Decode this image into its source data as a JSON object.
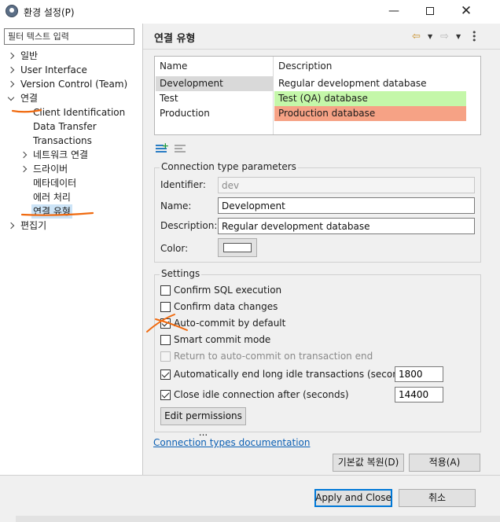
{
  "window": {
    "title": "환경 설정(P)",
    "minimize_glyph": "—",
    "close_glyph": "✕"
  },
  "sidebar": {
    "filter_placeholder": "필터 텍스트 입력",
    "items": [
      {
        "label": "일반",
        "expanded": false
      },
      {
        "label": "User Interface",
        "expanded": false
      },
      {
        "label": "Version Control (Team)",
        "expanded": false
      },
      {
        "label": "연결",
        "expanded": true
      },
      {
        "label": "편집기",
        "expanded": false
      }
    ],
    "connection_children": [
      {
        "label": "Client Identification"
      },
      {
        "label": "Data Transfer"
      },
      {
        "label": "Transactions"
      },
      {
        "label": "네트워크 연결",
        "has_children": true
      },
      {
        "label": "드라이버",
        "has_children": true
      },
      {
        "label": "메타데이터"
      },
      {
        "label": "에러 처리"
      },
      {
        "label": "연결 유형",
        "selected": true
      }
    ]
  },
  "page": {
    "title": "연결 유형",
    "icons": [
      "back-arrow-icon",
      "forward-arrow-icon",
      "more-vertical-icon"
    ]
  },
  "types_table": {
    "columns": [
      "Name",
      "Description"
    ],
    "rows": [
      {
        "name": "Development",
        "description": "Regular development database",
        "color": "#ffffff",
        "selected": true
      },
      {
        "name": "Test",
        "description": "Test (QA) database",
        "color": "#c4f7a9"
      },
      {
        "name": "Production",
        "description": "Production database",
        "color": "#f6a285"
      }
    ]
  },
  "params": {
    "group_title": "Connection type parameters",
    "identifier_label": "Identifier:",
    "identifier_value": "dev",
    "name_label": "Name:",
    "name_value": "Development",
    "description_label": "Description:",
    "description_value": "Regular development database",
    "color_label": "Color:",
    "color_value": "#ffffff"
  },
  "settings": {
    "group_title": "Settings",
    "options": [
      {
        "label": "Confirm SQL execution",
        "checked": false,
        "disabled": false
      },
      {
        "label": "Confirm data changes",
        "checked": false,
        "disabled": false
      },
      {
        "label": "Auto-commit by default",
        "checked": true,
        "disabled": false
      },
      {
        "label": "Smart commit mode",
        "checked": false,
        "disabled": false
      },
      {
        "label": "Return to auto-commit on transaction end",
        "checked": false,
        "disabled": true
      },
      {
        "label": "Automatically end long idle transactions (seconds)",
        "checked": true,
        "disabled": false,
        "value": "1800"
      },
      {
        "label": "Close idle connection after (seconds)",
        "checked": true,
        "disabled": false,
        "value": "14400"
      }
    ],
    "edit_permissions_label": "Edit permissions ..."
  },
  "docs_link": "Connection types documentation",
  "buttons": {
    "restore_defaults": "기본값 복원(D)",
    "apply": "적용(A)",
    "apply_and_close": "Apply and Close",
    "cancel": "취소"
  }
}
